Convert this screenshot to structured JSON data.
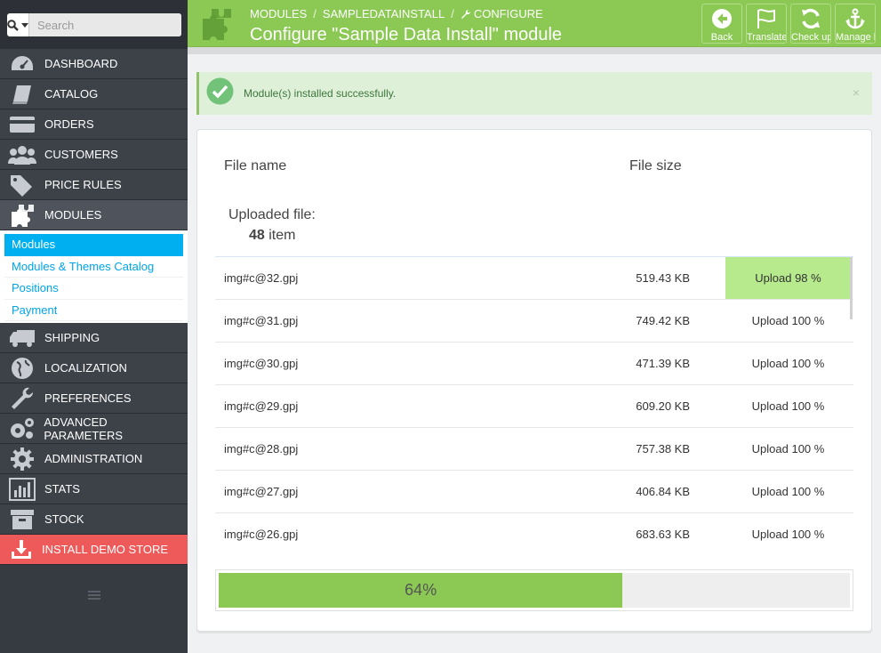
{
  "search": {
    "placeholder": "Search"
  },
  "sidebar": {
    "menu_top": [
      {
        "label": "DASHBOARD",
        "icon": "dashboard-icon"
      },
      {
        "label": "CATALOG",
        "icon": "book-icon"
      },
      {
        "label": "ORDERS",
        "icon": "credit-card-icon"
      },
      {
        "label": "CUSTOMERS",
        "icon": "users-icon"
      },
      {
        "label": "PRICE RULES",
        "icon": "tags-icon"
      },
      {
        "label": "MODULES",
        "icon": "puzzle-icon"
      }
    ],
    "submenu": [
      "Modules",
      "Modules & Themes Catalog",
      "Positions",
      "Payment"
    ],
    "menu_bottom": [
      {
        "label": "SHIPPING",
        "icon": "truck-icon"
      },
      {
        "label": "LOCALIZATION",
        "icon": "globe-icon"
      },
      {
        "label": "PREFERENCES",
        "icon": "wrench-icon"
      },
      {
        "label": "ADVANCED PARAMETERS",
        "icon": "cogs-icon"
      },
      {
        "label": "ADMINISTRATION",
        "icon": "gear-icon"
      },
      {
        "label": "STATS",
        "icon": "bar-chart-icon"
      },
      {
        "label": "STOCK",
        "icon": "archive-icon"
      }
    ],
    "demo": {
      "label": "INSTALL DEMO STORE",
      "icon": "download-icon",
      "color": "#ee5a5a"
    }
  },
  "header": {
    "breadcrumb": [
      "MODULES",
      "SAMPLEDATAINSTALL",
      "CONFIGURE"
    ],
    "title": "Configure \"Sample Data Install\" module",
    "accent": "#8bc954",
    "toolbar": [
      {
        "label": "Back",
        "icon": "arrow-left-icon"
      },
      {
        "label": "Translate",
        "icon": "flag-icon"
      },
      {
        "label": "Check update",
        "icon": "refresh-icon"
      },
      {
        "label": "Manage hooks",
        "icon": "anchor-icon"
      }
    ]
  },
  "alert": {
    "message": "Module(s) installed successfully.",
    "close": "×"
  },
  "panel": {
    "col_file": "File name",
    "col_size": "File size",
    "uploaded_label": "Uploaded file:",
    "uploaded_count": "48",
    "uploaded_unit": "item",
    "rows": [
      {
        "name": "img#c@32.gpj",
        "size": "519.43 KB",
        "status": "Upload 98 %"
      },
      {
        "name": "img#c@31.gpj",
        "size": "749.42 KB",
        "status": "Upload 100 %"
      },
      {
        "name": "img#c@30.gpj",
        "size": "471.39 KB",
        "status": "Upload 100 %"
      },
      {
        "name": "img#c@29.gpj",
        "size": "609.20 KB",
        "status": "Upload 100 %"
      },
      {
        "name": "img#c@28.gpj",
        "size": "757.38 KB",
        "status": "Upload 100 %"
      },
      {
        "name": "img#c@27.gpj",
        "size": "406.84 KB",
        "status": "Upload 100 %"
      },
      {
        "name": "img#c@26.gpj",
        "size": "683.63 KB",
        "status": "Upload 100 %"
      }
    ],
    "progress": {
      "value": 0.64,
      "text": "64%"
    }
  }
}
